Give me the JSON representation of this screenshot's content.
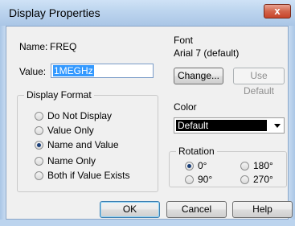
{
  "window": {
    "title": "Display Properties",
    "close_glyph": "x"
  },
  "name": {
    "label": "Name:",
    "value": "FREQ"
  },
  "value": {
    "label": "Value:",
    "field_value": "1MEGHz"
  },
  "display_format": {
    "title": "Display Format",
    "options": [
      {
        "label": "Do Not Display",
        "checked": false
      },
      {
        "label": "Value Only",
        "checked": false
      },
      {
        "label": "Name and Value",
        "checked": true
      },
      {
        "label": "Name Only",
        "checked": false
      },
      {
        "label": "Both if Value Exists",
        "checked": false
      }
    ]
  },
  "font": {
    "title": "Font",
    "current": "Arial 7 (default)",
    "change_label": "Change...",
    "use_default_label": "Use Default"
  },
  "color": {
    "title": "Color",
    "selected": "Default"
  },
  "rotation": {
    "title": "Rotation",
    "options": [
      {
        "label": "0°",
        "checked": true
      },
      {
        "label": "180°",
        "checked": false
      },
      {
        "label": "90°",
        "checked": false
      },
      {
        "label": "270°",
        "checked": false
      }
    ]
  },
  "buttons": {
    "ok": "OK",
    "cancel": "Cancel",
    "help": "Help"
  }
}
